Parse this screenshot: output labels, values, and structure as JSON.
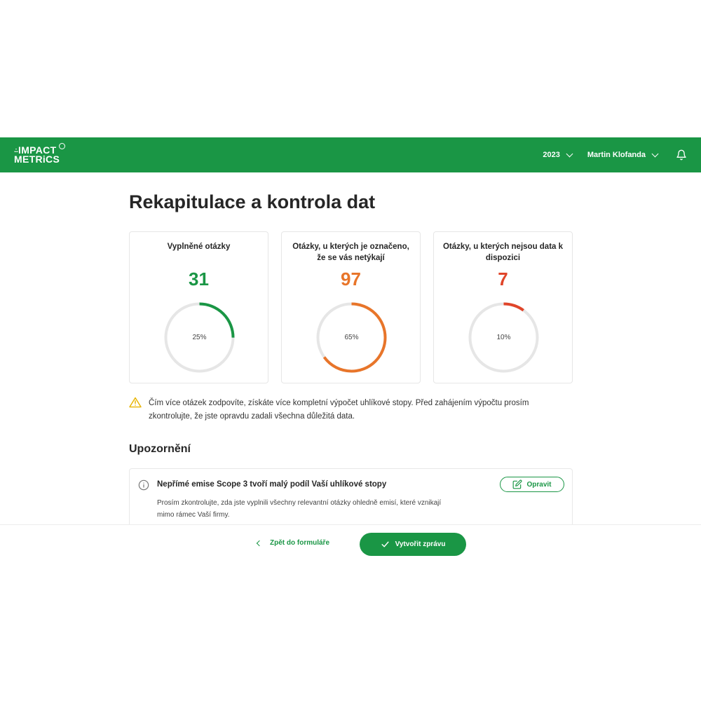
{
  "header": {
    "logo_line1": "IMPACT",
    "logo_line2": "METRiCS",
    "year": "2023",
    "user": "Martin Klofanda"
  },
  "page": {
    "title": "Rekapitulace a kontrola dat"
  },
  "cards": [
    {
      "title": "Vyplněné otázky",
      "value": "31",
      "percent_label": "25%",
      "fraction": 0.25,
      "color": "#1a9645"
    },
    {
      "title": "Otázky, u kterých je označeno, že se vás netýkají",
      "value": "97",
      "percent_label": "65%",
      "fraction": 0.65,
      "color": "#e8752a"
    },
    {
      "title": "Otázky, u kterých nejsou data k dispozici",
      "value": "7",
      "percent_label": "10%",
      "fraction": 0.1,
      "color": "#e0452a"
    }
  ],
  "notice": {
    "text": "Čím více otázek zodpovíte, získáte více kompletní výpočet uhlíkové stopy. Před zahájením výpočtu prosím zkontrolujte, že jste opravdu zadali všechna důležitá data."
  },
  "warnings": {
    "title": "Upozornění",
    "items": [
      {
        "title": "Nepřímé emise Scope 3 tvoří malý podíl Vaší uhlíkové stopy",
        "description": "Prosím zkontrolujte, zda jste vyplnili všechny relevantní otázky ohledně emisí, které vznikají mimo rámec Vaší firmy.",
        "button": "Opravit"
      }
    ]
  },
  "footer": {
    "back_label": "Zpět do formuláře",
    "create_label": "Vytvořit zprávu"
  },
  "colors": {
    "brand_green": "#1a9645",
    "orange": "#e8752a",
    "red": "#e0452a",
    "track": "#e6e6e6",
    "warning": "#e8b400"
  },
  "icons": [
    "bell-icon",
    "warning-icon",
    "info-icon",
    "edit-icon",
    "check-icon",
    "chevron-left-icon",
    "chevron-down-icon"
  ]
}
